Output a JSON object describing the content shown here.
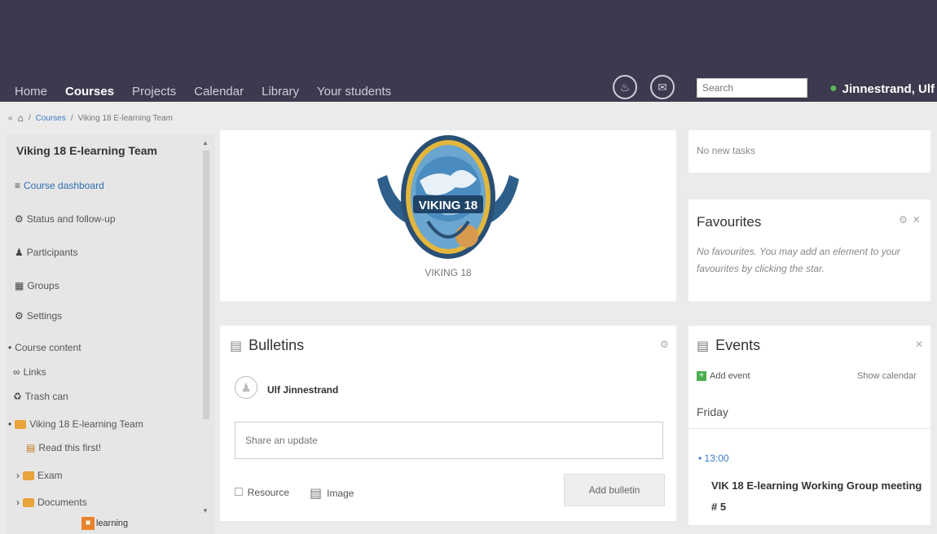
{
  "nav": {
    "items": [
      {
        "label": "Home",
        "active": false
      },
      {
        "label": "Courses",
        "active": true
      },
      {
        "label": "Projects",
        "active": false
      },
      {
        "label": "Calendar",
        "active": false
      },
      {
        "label": "Library",
        "active": false
      },
      {
        "label": "Your students",
        "active": false
      }
    ],
    "search_placeholder": "Search",
    "user_name": "Jinnestrand, Ulf"
  },
  "breadcrumb": {
    "courses": "Courses",
    "current": "Viking 18 E-learning Team"
  },
  "sidebar": {
    "title": "Viking 18 E-learning Team",
    "items": [
      {
        "label": "Course dashboard",
        "icon": "dashboard-icon"
      },
      {
        "label": "Status and follow-up",
        "icon": "status-icon"
      },
      {
        "label": "Participants",
        "icon": "participants-icon"
      },
      {
        "label": "Groups",
        "icon": "groups-icon"
      },
      {
        "label": "Settings",
        "icon": "gear-icon"
      }
    ],
    "section_label": "Course content",
    "content": [
      {
        "label": "Links"
      },
      {
        "label": "Trash can"
      },
      {
        "label": "Viking 18 E-learning Team"
      },
      {
        "label": "Read this first!"
      },
      {
        "label": "Exam"
      },
      {
        "label": "Documents"
      }
    ],
    "sub_item_label": "learning"
  },
  "logo_card": {
    "logo_text": "VIKING 18",
    "caption": "VIKING 18"
  },
  "bulletins": {
    "title": "Bulletins",
    "author": "Ulf Jinnestrand",
    "share_placeholder": "Share an update",
    "resource_label": "Resource",
    "image_label": "Image",
    "add_button": "Add bulletin"
  },
  "tasks": {
    "empty_text": "No new tasks"
  },
  "favourites": {
    "title": "Favourites",
    "description": "No favourites. You may add an element to your favourites by clicking the star."
  },
  "events": {
    "title": "Events",
    "add_event": "Add event",
    "show_calendar": "Show calendar",
    "day": "Friday",
    "items": [
      {
        "time": "13:00",
        "name": "VIK 18 E-learning Working Group meeting # 5"
      }
    ]
  },
  "colors": {
    "topbar": "#3d3a4f",
    "link": "#3a7bc8",
    "folder": "#e8a33c",
    "accent_green": "#4caf50"
  }
}
